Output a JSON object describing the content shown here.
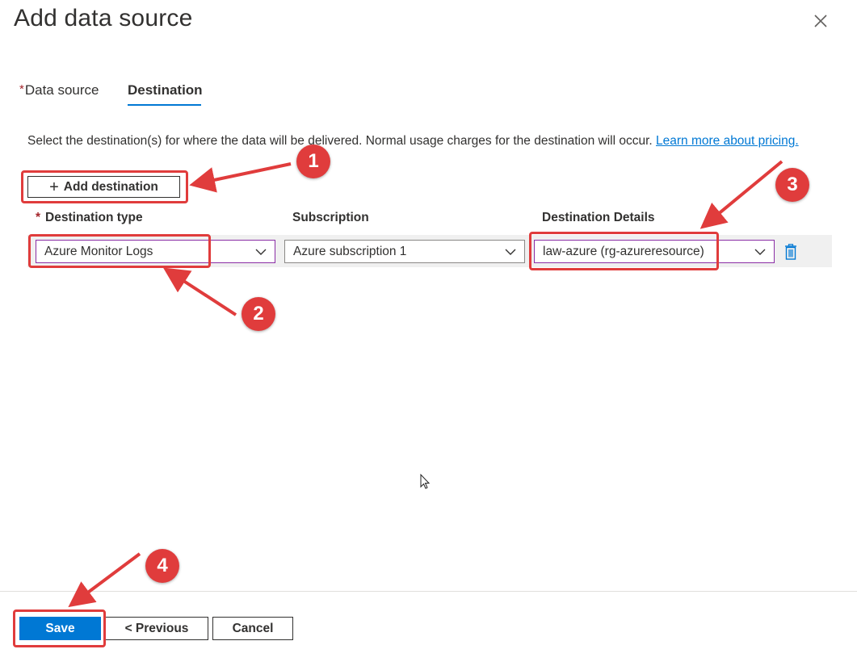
{
  "header": {
    "title": "Add data source"
  },
  "tabs": [
    {
      "label": "Data source",
      "required": "*"
    },
    {
      "label": "Destination"
    }
  ],
  "description": {
    "text": "Select the destination(s) for where the data will be delivered. Normal usage charges for the destination will occur.",
    "link": "Learn more about pricing."
  },
  "add_destination": {
    "icon": "+",
    "label": "Add destination"
  },
  "columns": {
    "required": "*",
    "destination_type": "Destination type",
    "subscription": "Subscription",
    "details": "Destination Details"
  },
  "row": {
    "destination_type": "Azure Monitor Logs",
    "subscription": "Azure subscription 1",
    "details": "law-azure (rg-azureresource)"
  },
  "footer": {
    "save": "Save",
    "previous": "< Previous",
    "cancel": "Cancel"
  },
  "annotations": {
    "b1": "1",
    "b2": "2",
    "b3": "3",
    "b4": "4"
  },
  "colors": {
    "accent": "#0078d4",
    "annotation": "#e03c3c",
    "required": "#a4262c"
  }
}
